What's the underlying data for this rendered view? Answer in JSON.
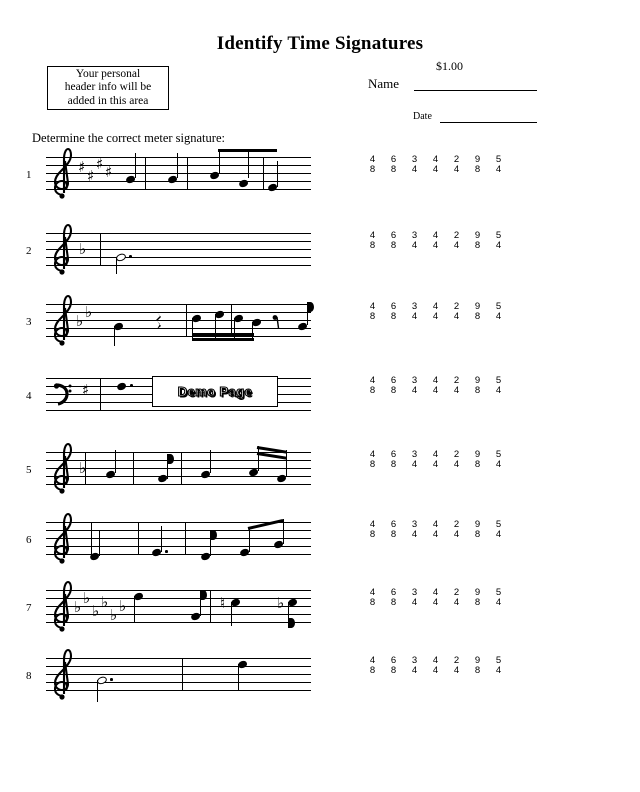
{
  "page": {
    "title": "Identify Time Signatures",
    "price": "$1.00",
    "name_label": "Name",
    "date_label": "Date",
    "instruction": "Determine the correct meter signature:",
    "header_box": {
      "line1": "Your personal",
      "line2": "header info will be",
      "line3": "added in this area"
    },
    "watermark": "Demo Page"
  },
  "answer_options": [
    {
      "top": "4",
      "bottom": "8"
    },
    {
      "top": "6",
      "bottom": "8"
    },
    {
      "top": "3",
      "bottom": "4"
    },
    {
      "top": "4",
      "bottom": "4"
    },
    {
      "top": "2",
      "bottom": "4"
    },
    {
      "top": "9",
      "bottom": "8"
    },
    {
      "top": "5",
      "bottom": "4"
    }
  ],
  "exercises": [
    {
      "number": "1",
      "clef": "treble-clef",
      "key_signature": "4-sharps",
      "contents": "quarter, quarter, quarter, beamed eighths"
    },
    {
      "number": "2",
      "clef": "treble-clef",
      "key_signature": "1-flat",
      "contents": "dotted half note"
    },
    {
      "number": "3",
      "clef": "treble-clef",
      "key_signature": "2-flats",
      "contents": "quarter, quarter rest, beamed sixteenths, eighth rest, eighth"
    },
    {
      "number": "4",
      "clef": "bass-clef",
      "key_signature": "1-sharp",
      "contents": "dotted note, hidden by demo watermark"
    },
    {
      "number": "5",
      "clef": "treble-clef",
      "key_signature": "1-flat",
      "contents": "quarter, eighth, quarter, beamed sixteenths"
    },
    {
      "number": "6",
      "clef": "treble-clef",
      "key_signature": "none",
      "contents": "quarter, dotted quarter, eighth, beamed eighths"
    },
    {
      "number": "7",
      "clef": "treble-clef",
      "key_signature": "6-flats",
      "contents": "quarter, eighth, natural quarter, flat quarter"
    },
    {
      "number": "8",
      "clef": "treble-clef",
      "key_signature": "none",
      "contents": "dotted half, quarter"
    }
  ]
}
